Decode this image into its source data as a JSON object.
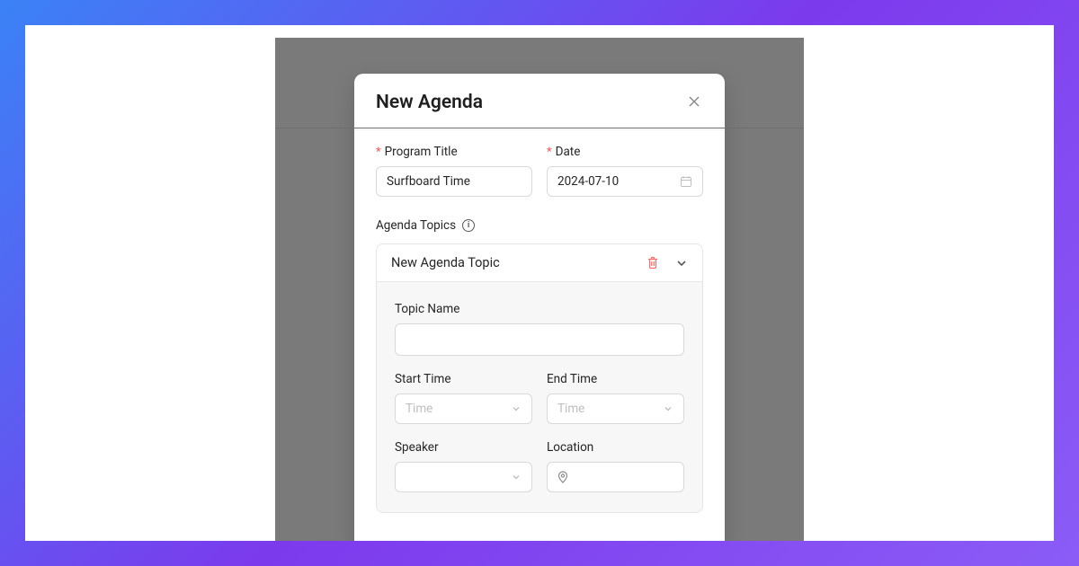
{
  "modal": {
    "title": "New Agenda",
    "programTitle": {
      "label": "Program Title",
      "value": "Surfboard Time"
    },
    "date": {
      "label": "Date",
      "value": "2024-07-10"
    },
    "agendaTopics": {
      "label": "Agenda Topics"
    },
    "topic": {
      "header": "New Agenda Topic",
      "topicName": {
        "label": "Topic Name",
        "value": ""
      },
      "startTime": {
        "label": "Start Time",
        "placeholder": "Time"
      },
      "endTime": {
        "label": "End Time",
        "placeholder": "Time"
      },
      "speaker": {
        "label": "Speaker"
      },
      "location": {
        "label": "Location"
      }
    }
  }
}
